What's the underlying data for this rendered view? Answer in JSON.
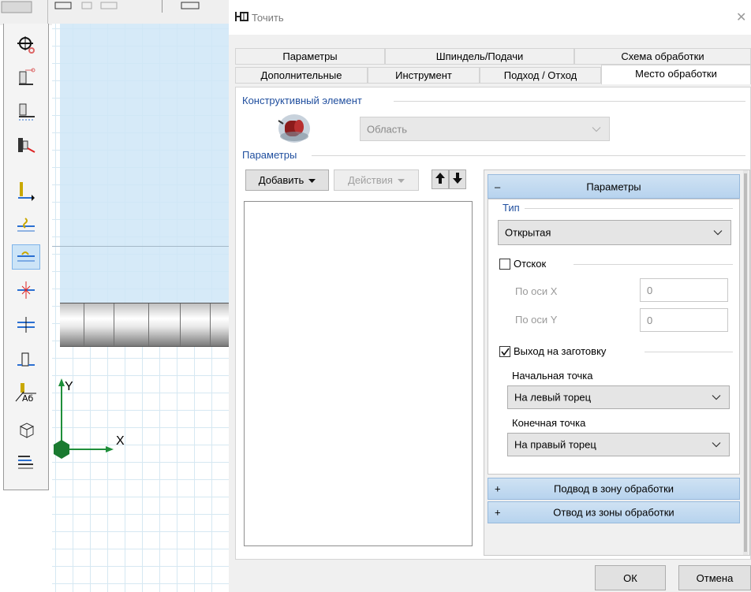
{
  "colors": {
    "dialog_bg": "#f0f0f0",
    "accent_header": "#b7d3ee",
    "group_label": "#1f4e9e",
    "canvas_highlight": "#cfe6f7"
  },
  "cad": {
    "toolbar_icons": [
      "origin-icon",
      "tool-setup-icon",
      "tool-holder-icon",
      "turning-tool-icon",
      "offset-icon",
      "adjust-icon",
      "facing-icon",
      "snap-point-icon",
      "axis-line-icon",
      "contour-icon",
      "text-annotation-icon",
      "3d-view-icon",
      "layers-icon"
    ],
    "axis_y_label": "Y",
    "axis_x_label": "X"
  },
  "dialog": {
    "title": "Точить",
    "tabs_row1": [
      "Параметры",
      "Шпиндель/Подачи",
      "Схема обработки"
    ],
    "tabs_row2": [
      "Дополнительные",
      "Инструмент",
      "Подход / Отход",
      "Место обработки"
    ],
    "active_tab": "Место обработки",
    "structural_group_label": "Конструктивный элемент",
    "region_combo_value": "Область",
    "params_group_label": "Параметры",
    "add_button": "Добавить",
    "actions_button": "Действия",
    "params_panel": {
      "header": "Параметры",
      "type_label": "Тип",
      "type_value": "Открытая",
      "bounce_label": "Отскок",
      "bounce_checked": false,
      "axis_x_label": "По оси X",
      "axis_x_value": "0",
      "axis_y_label": "По оси Y",
      "axis_y_value": "0",
      "exit_label": "Выход на заготовку",
      "exit_checked": true,
      "start_point_label": "Начальная точка",
      "start_point_value": "На левый торец",
      "end_point_label": "Конечная точка",
      "end_point_value": "На правый торец"
    },
    "section_approach": "Подвод в зону обработки",
    "section_retract": "Отвод из зоны обработки",
    "ok_button": "ОК",
    "cancel_button": "Отмена"
  }
}
